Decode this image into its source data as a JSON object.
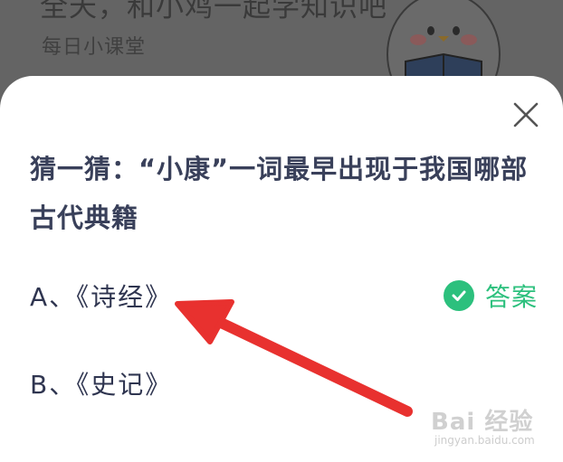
{
  "background": {
    "title": "全天，和小鸡一起学知识吧",
    "subtitle": "每日小课堂"
  },
  "quiz": {
    "question": "猜一猜：“小康”一词最早出现于我国哪部古代典籍",
    "options": [
      {
        "label": "A、《诗经》"
      },
      {
        "label": "B、《史记》"
      }
    ],
    "answer_label": "答案"
  },
  "watermark": {
    "main": "Bai 经验",
    "sub": "jingyan.baidu.com"
  },
  "colors": {
    "accent_green": "#2cc07d",
    "arrow_red": "#e8312f",
    "text_dark": "#39405a"
  }
}
